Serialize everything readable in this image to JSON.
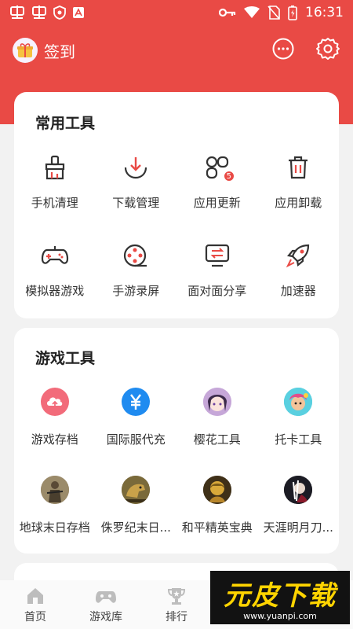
{
  "status_bar": {
    "time": "16:31"
  },
  "header": {
    "checkin_label": "签到"
  },
  "common_tools": {
    "title": "常用工具",
    "items": [
      {
        "label": "手机清理",
        "icon": "broom-icon"
      },
      {
        "label": "下载管理",
        "icon": "download-icon"
      },
      {
        "label": "应用更新",
        "icon": "app-update-icon",
        "badge": "5"
      },
      {
        "label": "应用卸载",
        "icon": "trash-icon"
      },
      {
        "label": "模拟器游戏",
        "icon": "gamepad-icon"
      },
      {
        "label": "手游录屏",
        "icon": "film-reel-icon"
      },
      {
        "label": "面对面分享",
        "icon": "transfer-icon"
      },
      {
        "label": "加速器",
        "icon": "rocket-icon"
      }
    ]
  },
  "game_tools": {
    "title": "游戏工具",
    "items": [
      {
        "label": "游戏存档",
        "icon": "cloud-upload-icon"
      },
      {
        "label": "国际服代充",
        "icon": "yen-icon"
      },
      {
        "label": "樱花工具",
        "icon": "anime-avatar-icon"
      },
      {
        "label": "托卡工具",
        "icon": "toca-avatar-icon"
      },
      {
        "label": "地球末日存档",
        "icon": "soldier-avatar-icon"
      },
      {
        "label": "侏罗纪末日...",
        "icon": "dino-avatar-icon"
      },
      {
        "label": "和平精英宝典",
        "icon": "peace-elite-avatar-icon"
      },
      {
        "label": "天涯明月刀...",
        "icon": "tianya-avatar-icon"
      }
    ]
  },
  "bottom_nav": [
    {
      "label": "首页",
      "icon": "home-icon"
    },
    {
      "label": "游戏库",
      "icon": "game-library-icon"
    },
    {
      "label": "排行",
      "icon": "trophy-icon"
    }
  ],
  "watermark": {
    "title": "元皮下载",
    "url": "www.yuanpi.com"
  },
  "colors": {
    "brand": "#e94a45",
    "background": "#f2f2f2"
  }
}
